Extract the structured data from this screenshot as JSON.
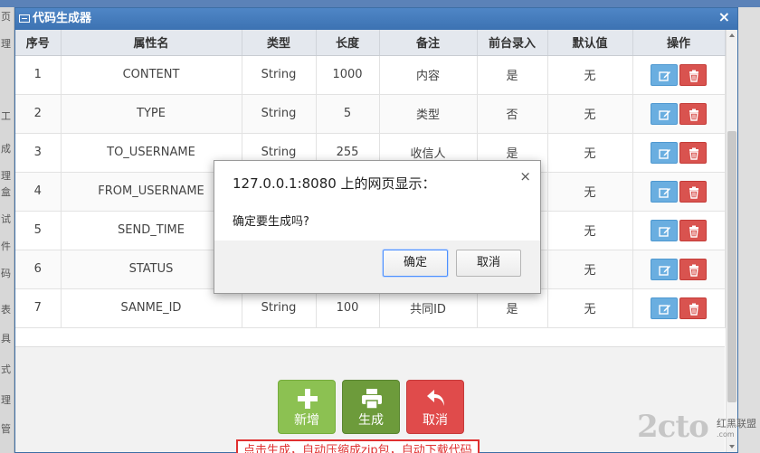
{
  "window": {
    "title": "代码生成器",
    "close_glyph": "×"
  },
  "table": {
    "columns": [
      "序号",
      "属性名",
      "类型",
      "长度",
      "备注",
      "前台录入",
      "默认值",
      "操作"
    ],
    "rows": [
      {
        "no": "1",
        "name": "CONTENT",
        "type": "String",
        "len": "1000",
        "note": "内容",
        "input": "是",
        "default": "无"
      },
      {
        "no": "2",
        "name": "TYPE",
        "type": "String",
        "len": "5",
        "note": "类型",
        "input": "否",
        "default": "无"
      },
      {
        "no": "3",
        "name": "TO_USERNAME",
        "type": "String",
        "len": "255",
        "note": "收信人",
        "input": "是",
        "default": "无"
      },
      {
        "no": "4",
        "name": "FROM_USERNAME",
        "type": "",
        "len": "",
        "note": "",
        "input": "",
        "default": "无"
      },
      {
        "no": "5",
        "name": "SEND_TIME",
        "type": "",
        "len": "",
        "note": "",
        "input": "",
        "default": "无"
      },
      {
        "no": "6",
        "name": "STATUS",
        "type": "",
        "len": "",
        "note": "",
        "input": "",
        "default": "无"
      },
      {
        "no": "7",
        "name": "SANME_ID",
        "type": "String",
        "len": "100",
        "note": "共同ID",
        "input": "是",
        "default": "无"
      }
    ]
  },
  "buttons": {
    "add": "新增",
    "generate": "生成",
    "cancel": "取消"
  },
  "annotation": "点击生成，自动压缩成zip包，自动下载代码",
  "dialog": {
    "title": "127.0.0.1:8080 上的网页显示：",
    "message": "确定要生成吗?",
    "ok": "确定",
    "cancel": "取消",
    "close_glyph": "×"
  },
  "watermark": {
    "main": "2cto",
    "side": "红黑联盟",
    "sub": ".com"
  },
  "background_sidebar": [
    "页",
    "理",
    "工具",
    "成",
    "理",
    "盒",
    "试",
    "件",
    "码",
    "表",
    "具",
    "式",
    "理",
    "管"
  ],
  "colors": {
    "title_bar": "#3c72b2",
    "edit": "#6aaee0",
    "delete": "#d9534f",
    "add": "#8cc152",
    "generate": "#6d9b3b",
    "cancel": "#e04b4b",
    "annotation": "#e03030"
  }
}
